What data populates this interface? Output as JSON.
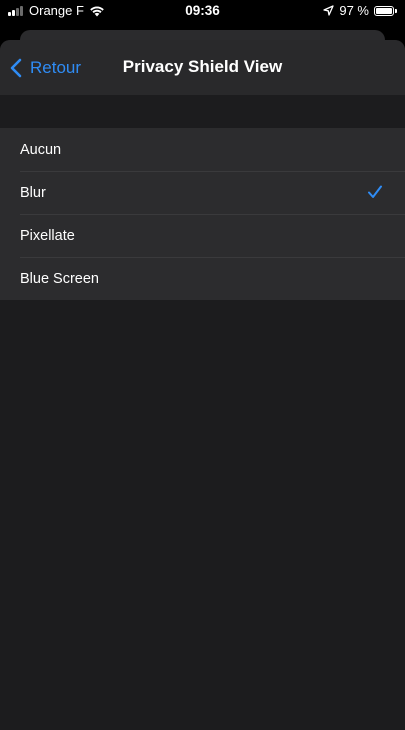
{
  "status_bar": {
    "carrier": "Orange F",
    "time": "09:36",
    "battery_percent": "97 %",
    "battery_level": 0.97,
    "signal_bars": 2,
    "icons": [
      "signal-icon",
      "wifi-icon",
      "location-arrow-icon",
      "battery-icon"
    ]
  },
  "nav": {
    "back_label": "Retour",
    "title": "Privacy Shield View"
  },
  "options": [
    {
      "label": "Aucun",
      "selected": false
    },
    {
      "label": "Blur",
      "selected": true
    },
    {
      "label": "Pixellate",
      "selected": false
    },
    {
      "label": "Blue Screen",
      "selected": false
    }
  ],
  "colors": {
    "accent": "#2f8cf5",
    "background": "#1c1c1e",
    "nav_background": "#29292b",
    "cell_background": "#2c2c2e",
    "separator": "#3a3a3c"
  }
}
